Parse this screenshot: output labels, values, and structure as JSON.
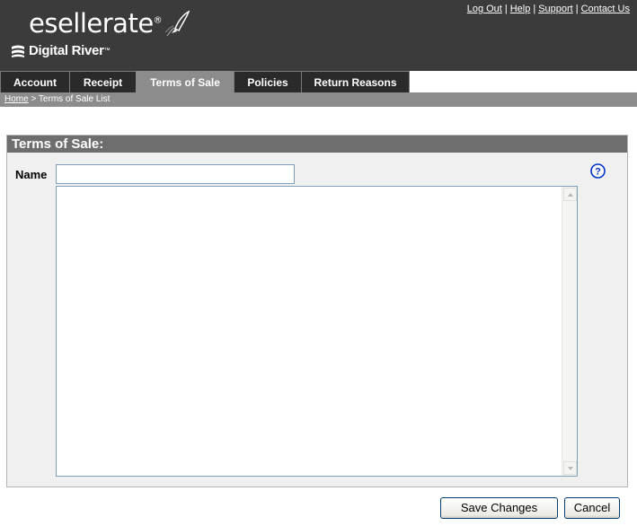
{
  "brand": {
    "product": "esellerate",
    "company": "Digital River"
  },
  "top_links": [
    "Log Out",
    "Help",
    "Support",
    "Contact Us"
  ],
  "tabs": [
    {
      "label": "Account"
    },
    {
      "label": "Receipt"
    },
    {
      "label": "Terms of Sale",
      "active": true
    },
    {
      "label": "Policies"
    },
    {
      "label": "Return Reasons"
    }
  ],
  "breadcrumb": {
    "home": "Home",
    "separator": ">",
    "current": "Terms of Sale List"
  },
  "panel": {
    "title": "Terms of Sale:",
    "name_label": "Name",
    "name_value": "",
    "body_value": "",
    "help_icon": "question-circle-icon"
  },
  "buttons": {
    "save": "Save Changes",
    "cancel": "Cancel"
  },
  "colors": {
    "header_bg": "#3b3b3b",
    "active_tab": "#8c8c8c",
    "panel_title_bg": "#6e6e6e",
    "help_icon": "#0033cc"
  }
}
